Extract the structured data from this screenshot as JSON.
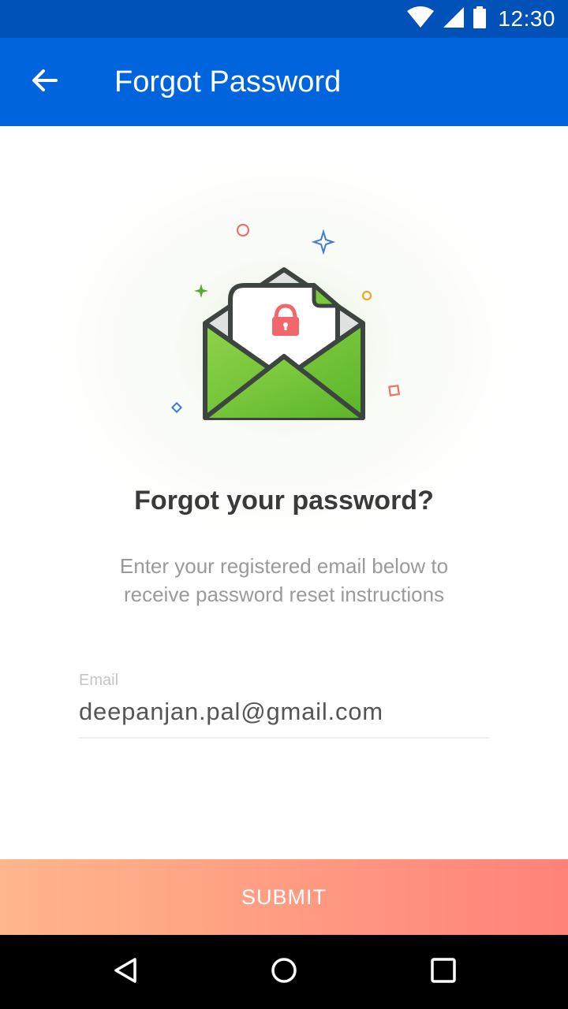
{
  "status_bar": {
    "time": "12:30",
    "icons": [
      "wifi-icon",
      "signal-icon",
      "battery-icon"
    ]
  },
  "app_bar": {
    "title": "Forgot Password",
    "back_icon": "arrow-back-icon"
  },
  "illustration": {
    "icon": "open-envelope-lock-icon",
    "colors": {
      "envelope": "#7cc83c",
      "lock": "#f2676c",
      "outline": "#3d4540"
    }
  },
  "main": {
    "heading": "Forgot your password?",
    "description": "Enter your registered email below to receive password reset instructions"
  },
  "email_field": {
    "label": "Email",
    "value": "deepanjan.pal@gmail.com"
  },
  "submit": {
    "label": "SUBMIT",
    "gradient": [
      "#ffb68c",
      "#ff8279"
    ]
  },
  "nav_bar": {
    "icons": [
      "back-triangle-icon",
      "home-circle-icon",
      "recents-square-icon"
    ]
  },
  "theme": {
    "primary": "#0064dc",
    "primary_dark": "#0052b8"
  }
}
